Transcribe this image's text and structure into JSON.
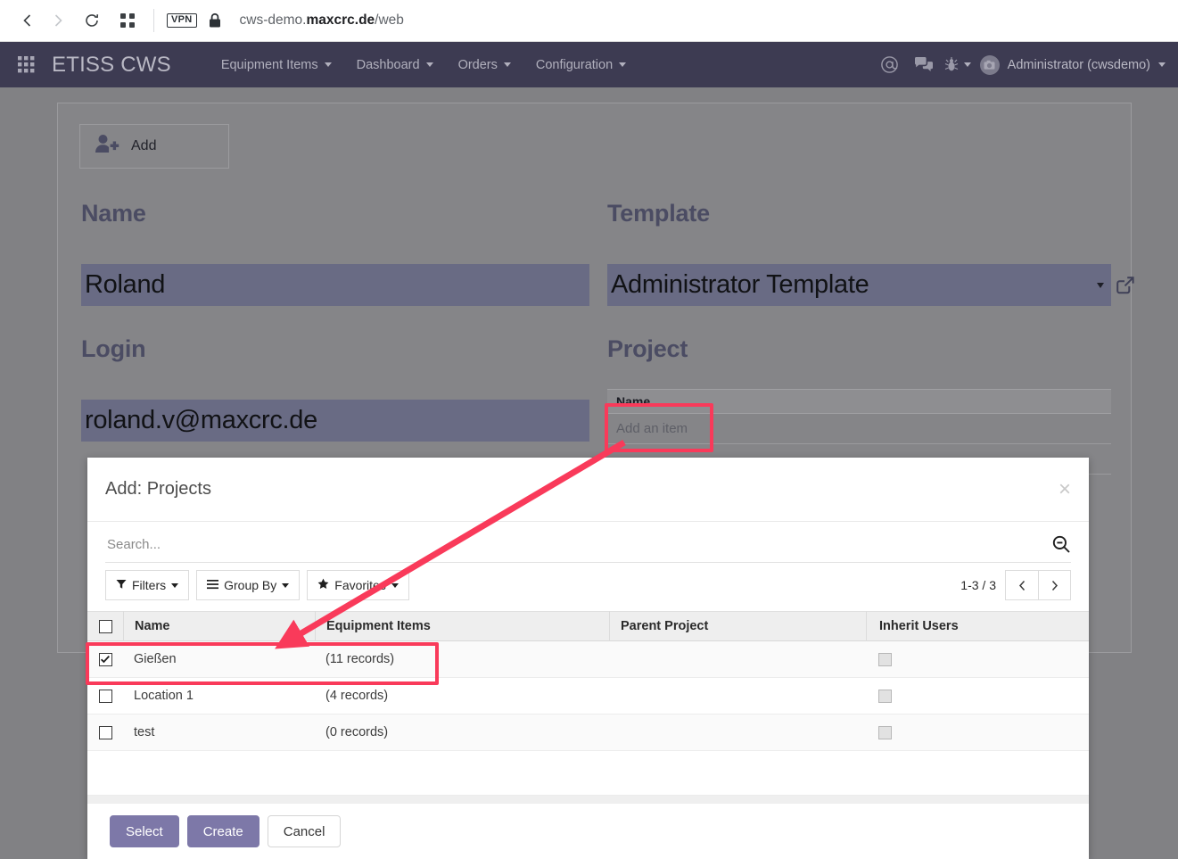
{
  "browser": {
    "url_prefix": "cws-demo.",
    "url_bold": "maxcrc.de",
    "url_suffix": "/web",
    "vpn_badge": "VPN",
    "back_icon": "back-arrow-icon",
    "forward_icon": "forward-arrow-icon",
    "reload_icon": "reload-icon",
    "apps_icon": "grid-apps-icon",
    "lock_icon": "lock-icon"
  },
  "navbar": {
    "brand": "ETISS CWS",
    "menus": [
      {
        "label": "Equipment Items"
      },
      {
        "label": "Dashboard"
      },
      {
        "label": "Orders"
      },
      {
        "label": "Configuration"
      }
    ],
    "icons": [
      {
        "name": "mentions-at-icon",
        "glyph": "@"
      },
      {
        "name": "messages-chat-icon"
      },
      {
        "name": "debug-bug-icon"
      }
    ],
    "user": "Administrator (cwsdemo)"
  },
  "form": {
    "add_button": "Add",
    "name_label": "Name",
    "name_value": "Roland",
    "login_label": "Login",
    "login_value": "roland.v@maxcrc.de",
    "template_label": "Template",
    "template_value": "Administrator Template",
    "project_label": "Project",
    "project_table_header": "Name",
    "project_add_row": "Add an item"
  },
  "modal": {
    "title": "Add: Projects",
    "close_label": "×",
    "search_placeholder": "Search...",
    "search_value": "",
    "filters_label": "Filters",
    "group_by_label": "Group By",
    "favorites_label": "Favorites",
    "pager_count": "1-3 / 3",
    "columns": [
      "Name",
      "Equipment Items",
      "Parent Project",
      "Inherit Users"
    ],
    "rows": [
      {
        "name": "Gießen",
        "equipment": "(11 records)",
        "parent": "",
        "checked": true
      },
      {
        "name": "Location 1",
        "equipment": "(4 records)",
        "parent": "",
        "checked": false
      },
      {
        "name": "test",
        "equipment": "(0 records)",
        "parent": "",
        "checked": false
      }
    ],
    "buttons": {
      "select": "Select",
      "create": "Create",
      "cancel": "Cancel"
    }
  },
  "colors": {
    "navbar": "#3d3b52",
    "field_fill": "#696b84",
    "annotation": "#f93a5a",
    "primary_button": "#7d78a8"
  }
}
